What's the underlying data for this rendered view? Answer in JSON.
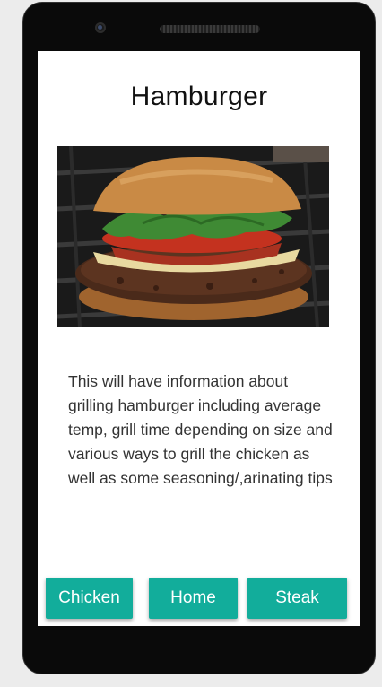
{
  "screen": {
    "title": "Hamburger",
    "image": {
      "icon": "hamburger-photo",
      "colors": {
        "background": "#1e1e1e",
        "bun": "#c98a45",
        "lettuce": "#3f8a34",
        "tomato": "#c4321f",
        "cheese": "#e8d9a0",
        "patty": "#4a2a1a"
      }
    },
    "description": "This will have information about grilling hamburger including average temp, grill time depending on size and various ways to grill the chicken as well as some seasoning/,arinating tips"
  },
  "nav": {
    "chicken_label": "Chicken",
    "home_label": "Home",
    "steak_label": "Steak",
    "accent_color": "#12ad9b"
  }
}
